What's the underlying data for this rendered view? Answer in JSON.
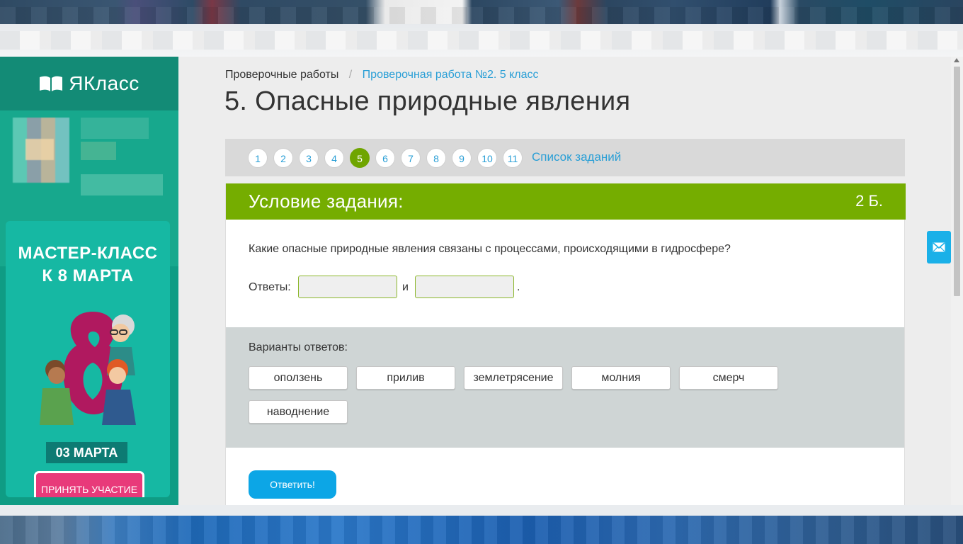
{
  "sidebar": {
    "logo_text": "ЯКласс",
    "promo": {
      "title_line1": "МАСТЕР-КЛАСС",
      "title_line2": "К 8 МАРТА",
      "date": "03 МАРТА",
      "button": "ПРИНЯТЬ УЧАСТИЕ"
    }
  },
  "breadcrumb": {
    "root": "Проверочные работы",
    "separator": "/",
    "current": "Проверочная работа №2. 5 класс"
  },
  "page_title": "5. Опасные природные явления",
  "pager": {
    "items": [
      "1",
      "2",
      "3",
      "4",
      "5",
      "6",
      "7",
      "8",
      "9",
      "10",
      "11"
    ],
    "active": "5",
    "list_link": "Список заданий"
  },
  "task": {
    "header": "Условие задания:",
    "points": "2 Б.",
    "question": "Какие опасные природные явления связаны с процессами, происходящими в гидросфере?",
    "answers_label": "Ответы:",
    "answer_1_value": "",
    "answer_2_value": "",
    "conjunction": "и",
    "end_mark": ".",
    "variants_label": "Варианты ответов:",
    "variants": [
      "оползень",
      "прилив",
      "землетрясение",
      "молния",
      "смерч",
      "наводнение"
    ],
    "submit_label": "Ответить!"
  },
  "colors": {
    "brand_teal": "#0f9c84",
    "task_green": "#75ad00",
    "link_blue": "#2a9fd6",
    "submit_blue": "#0ca6e6"
  },
  "icons": {
    "logo": "book-icon",
    "feedback": "mail-icon"
  }
}
